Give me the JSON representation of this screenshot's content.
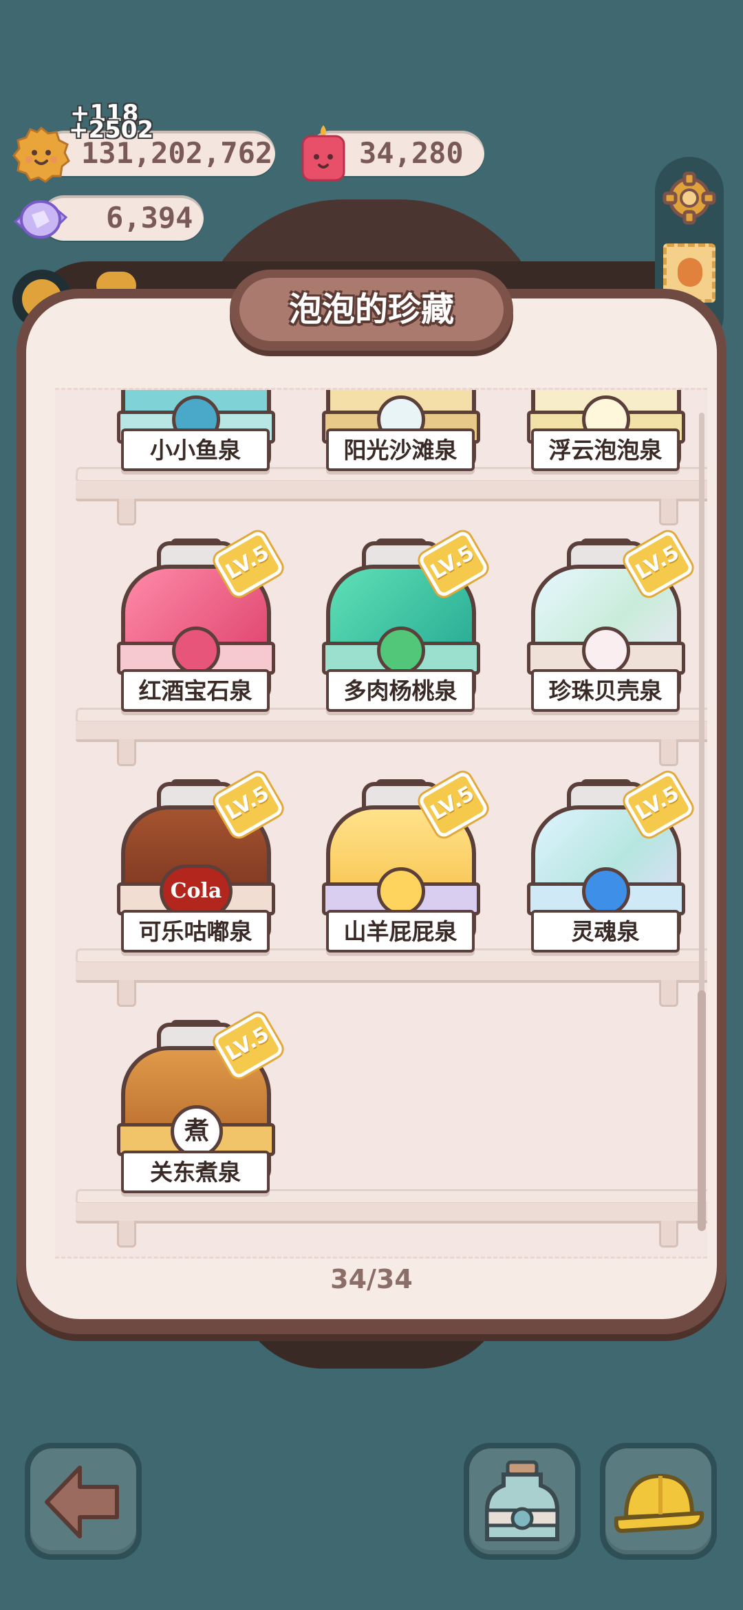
{
  "currencies": {
    "cookies": {
      "value": "131,202,762",
      "gains": [
        "+118",
        "+2502"
      ],
      "icon": "cookie-face-icon"
    },
    "candle": {
      "value": "34,280",
      "icon": "candle-face-icon"
    },
    "crystal": {
      "value": "6,394",
      "icon": "crystal-candy-icon"
    }
  },
  "panel": {
    "title": "泡泡的珍藏",
    "page_count": "34/34"
  },
  "jars": [
    {
      "name": "小小鱼泉",
      "level": null,
      "color": "#7fd2d6",
      "emblem": "fish-icon"
    },
    {
      "name": "阳光沙滩泉",
      "level": null,
      "color": "#e7c98a",
      "emblem": "shell-icon"
    },
    {
      "name": "浮云泡泡泉",
      "level": null,
      "color": "#f2e2a8",
      "emblem": "bubbles-icon"
    },
    {
      "name": "红酒宝石泉",
      "level": "LV.5",
      "color": "#e8557a",
      "emblem": "gem-icon"
    },
    {
      "name": "多肉杨桃泉",
      "level": "LV.5",
      "color": "#31c3a3",
      "emblem": "star-icon"
    },
    {
      "name": "珍珠贝壳泉",
      "level": "LV.5",
      "color": "#c8e9e4",
      "emblem": "pearl-shell-icon"
    },
    {
      "name": "可乐咕嘟泉",
      "level": "LV.5",
      "color": "#8a3e2a",
      "emblem": "cola-icon",
      "emblem_text": "Cola"
    },
    {
      "name": "山羊屁屁泉",
      "level": "LV.5",
      "color": "#f5c94b",
      "emblem": "goat-cloud-icon"
    },
    {
      "name": "灵魂泉",
      "level": "LV.5",
      "color": "#9bd7ea",
      "emblem": "soul-blob-icon"
    },
    {
      "name": "关东煮泉",
      "level": "LV.5",
      "color": "#c47a35",
      "emblem": "oden-icon",
      "emblem_text": "煮"
    }
  ],
  "buttons": {
    "back": "back-arrow-icon",
    "jar": "jar-icon",
    "helmet": "helmet-icon"
  },
  "colors": {
    "background": "#3f6870",
    "panel_frame": "#6e4a42",
    "panel_inner": "#f7ebe6",
    "level_badge": "#f5c94b"
  }
}
